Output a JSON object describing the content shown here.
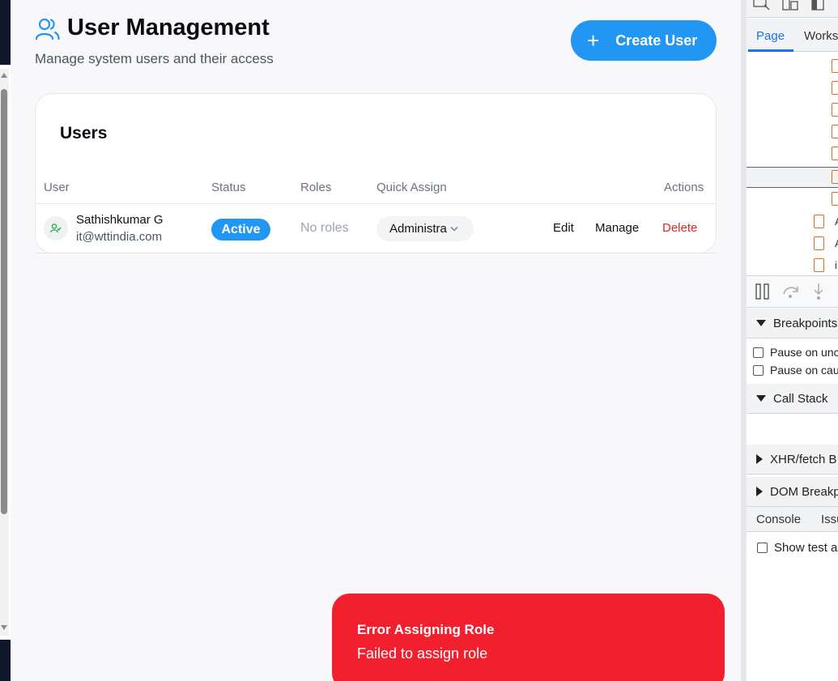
{
  "header": {
    "title": "User Management",
    "subtitle": "Manage system users and their access",
    "create_button_label": "Create User"
  },
  "users_card": {
    "title": "Users",
    "columns": [
      "User",
      "Status",
      "Roles",
      "Quick Assign",
      "Actions"
    ],
    "rows": [
      {
        "name": "Sathishkumar G",
        "email": "it@wttindia.com",
        "status": "Active",
        "roles": "No roles",
        "quick_assign": "Administra",
        "actions": [
          "Edit",
          "Manage",
          "Delete"
        ]
      }
    ]
  },
  "toast": {
    "title": "Error Assigning Role",
    "message": "Failed to assign role"
  },
  "devtools": {
    "tabs": [
      "Page",
      "Works"
    ],
    "tree_labels": [
      "A",
      "A",
      "i"
    ],
    "sections": {
      "breakpoints": "Breakpoints",
      "pause_uncaught": "Pause on unc",
      "pause_caught": "Pause on cau",
      "call_stack": "Call Stack",
      "xhr": "XHR/fetch B",
      "dom": "DOM Breakp"
    },
    "console_tabs": [
      "Console",
      "Issu"
    ],
    "show_test": "Show test a"
  },
  "colors": {
    "accent": "#2196f3",
    "danger": "#dc2626",
    "toast_bg": "#f21f2e",
    "devtools_accent": "#1a73e8"
  }
}
